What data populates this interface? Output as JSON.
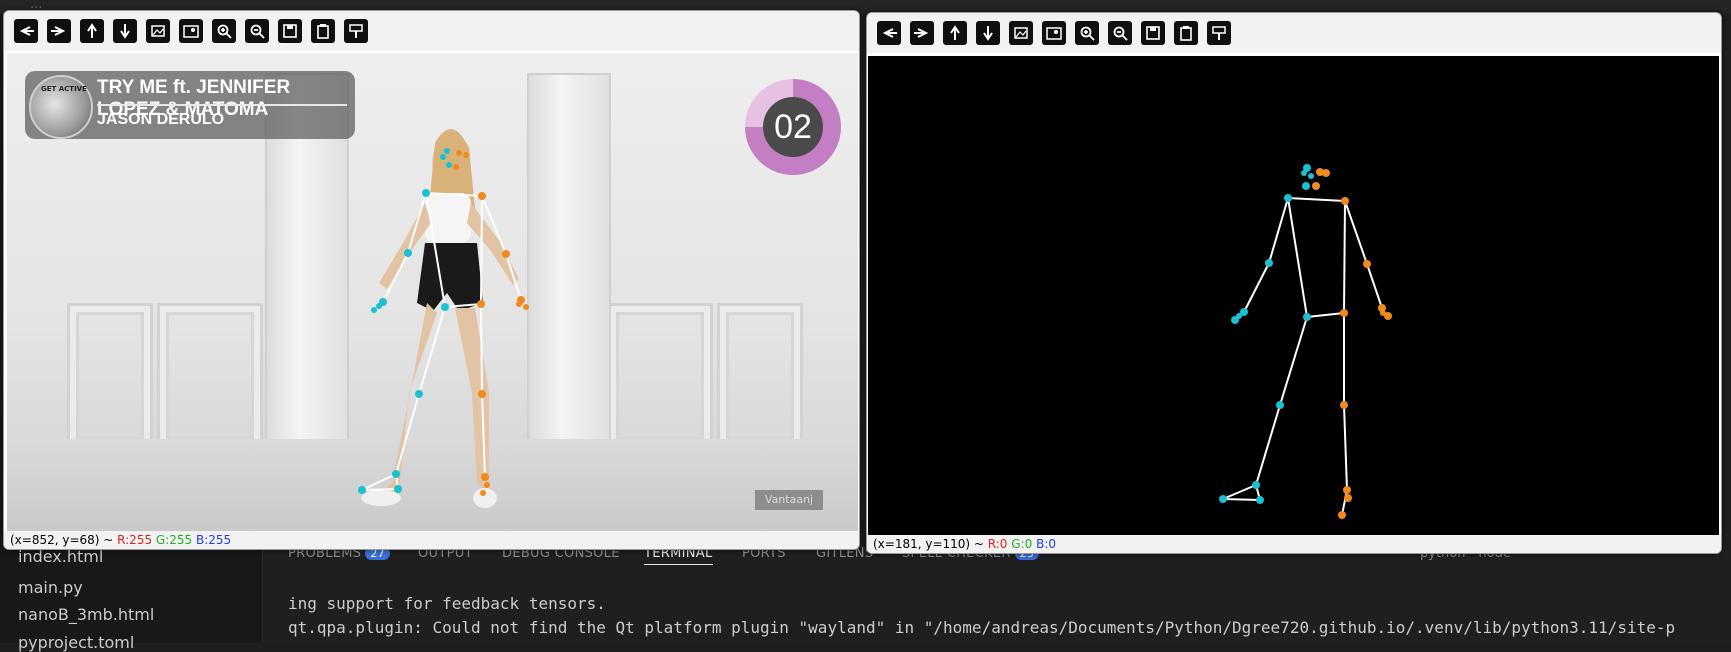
{
  "vscode": {
    "window_title": "...",
    "files": [
      {
        "name": "index.html"
      },
      {
        "name": "main.py"
      },
      {
        "name": "nanoB_3mb.html"
      },
      {
        "name": "pyproject.toml"
      }
    ],
    "panel_tabs": [
      {
        "label": "PROBLEMS",
        "badge": "27"
      },
      {
        "label": "OUTPUT"
      },
      {
        "label": "DEBUG CONSOLE"
      },
      {
        "label": "TERMINAL",
        "active": true
      },
      {
        "label": "PORTS"
      },
      {
        "label": "GITLENS"
      },
      {
        "label": "SPELL CHECKER",
        "badge": "25"
      }
    ],
    "terminal_selector": "python - node",
    "terminal_lines": [
      "ing support for feedback tensors.",
      "qt.qpa.plugin: Could not find the Qt platform plugin \"wayland\" in \"/home/andreas/Documents/Python/Dgree720.github.io/.venv/lib/python3.11/site-p"
    ]
  },
  "toolbar_icons": [
    "back-icon",
    "forward-icon",
    "pan-up-icon",
    "pan-down-icon",
    "image-icon",
    "subplots-icon",
    "zoom-in-icon",
    "zoom-out-icon",
    "save-icon",
    "clipboard-icon",
    "settings-icon"
  ],
  "left_window": {
    "status": {
      "coords": "(x=852, y=68) ~ ",
      "r": "R:255",
      "g": "G:255",
      "b": "B:255"
    },
    "video": {
      "song_title": "TRY ME ft. JENNIFER LOPEZ & MATOMA",
      "artist": "JASON DERULO",
      "avatar_text": "GET ACTIVE",
      "counter": "02",
      "watermark": "Vantaanj"
    }
  },
  "right_window": {
    "status": {
      "coords": "(x=181, y=110) ~ ",
      "r": "R:0",
      "g": "G:0",
      "b": "B:0"
    }
  },
  "colors": {
    "left_joint": "#19c1d3",
    "right_joint": "#f08a1c",
    "bone": "#ffffff",
    "plot_bg": "#000000"
  }
}
